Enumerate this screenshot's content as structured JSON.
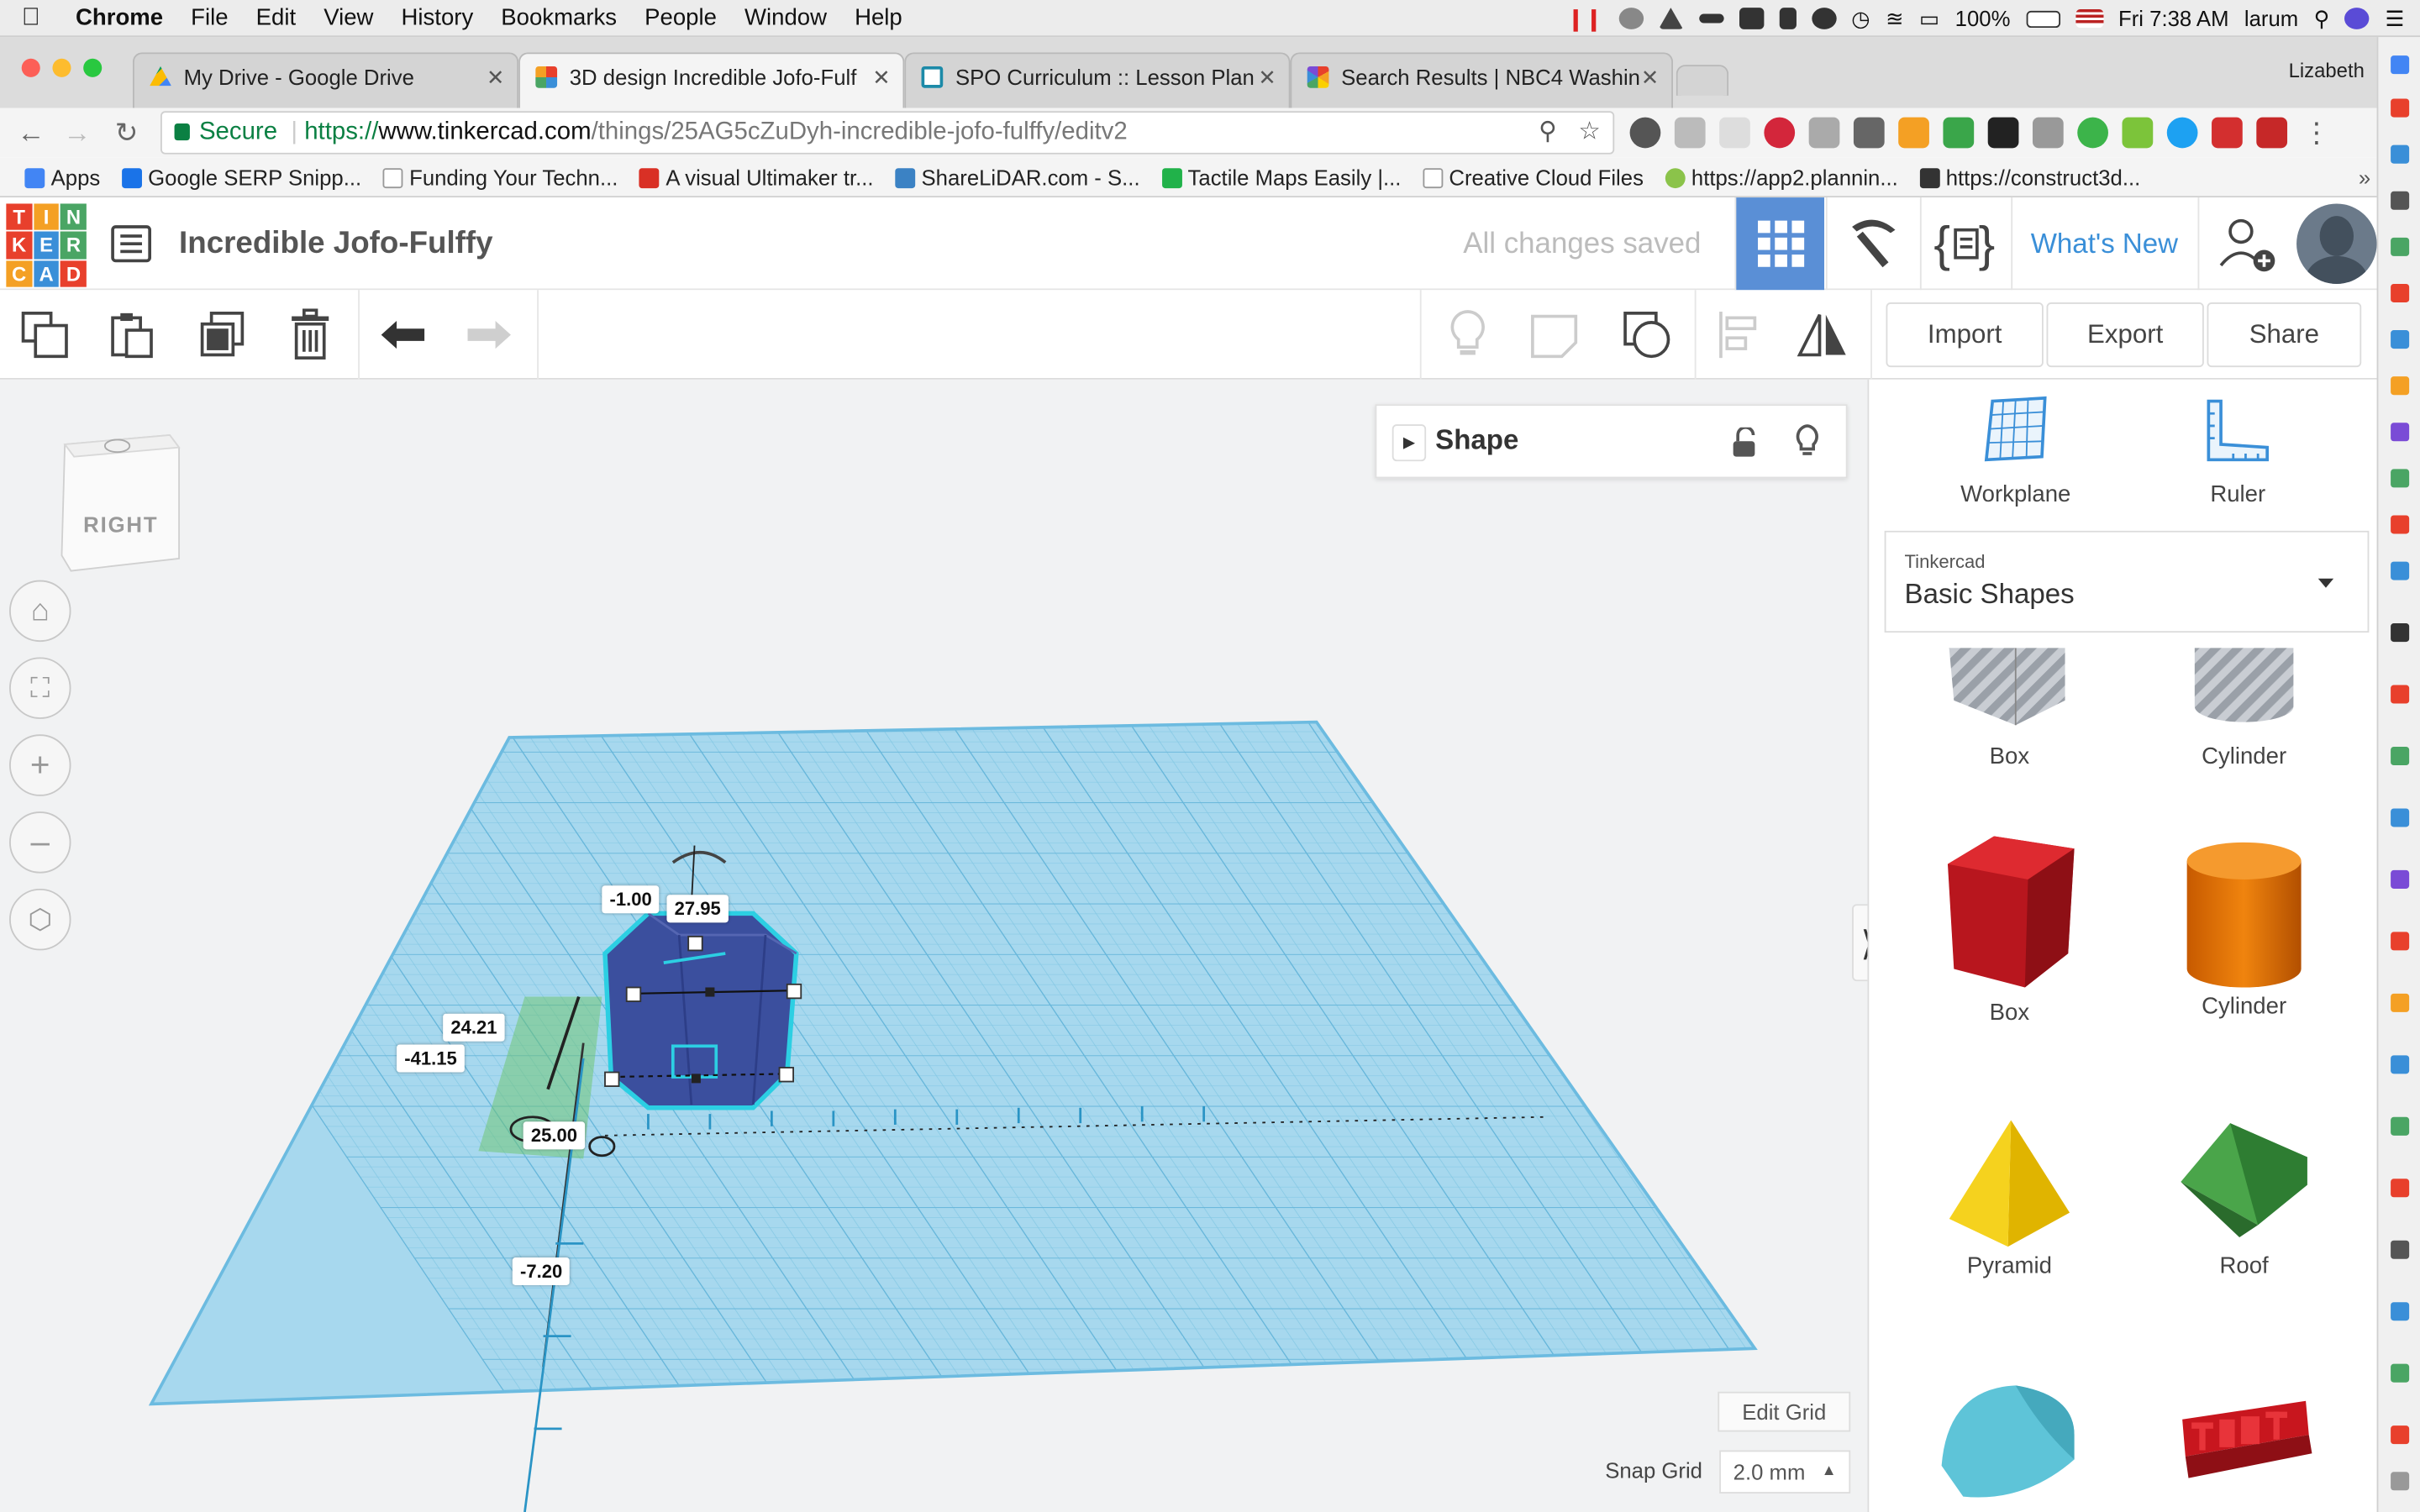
{
  "mac_menu": {
    "app": "Chrome",
    "items": [
      "File",
      "Edit",
      "View",
      "History",
      "Bookmarks",
      "People",
      "Window",
      "Help"
    ],
    "battery": "100%",
    "clock": "Fri 7:38 AM",
    "user": "larum"
  },
  "browser": {
    "profile_name": "Lizabeth",
    "tabs": [
      {
        "title": "My Drive - Google Drive",
        "icon": "google-drive-icon"
      },
      {
        "title": "3D design Incredible Jofo-Fulf​",
        "icon": "tinkercad-icon"
      },
      {
        "title": "SPO Curriculum :: Lesson Plan​",
        "icon": "lesson-icon"
      },
      {
        "title": "Search Results | NBC4 Washin​",
        "icon": "nbc-icon"
      }
    ],
    "active_tab_index": 1,
    "url": {
      "secure_label": "Secure",
      "scheme": "https://",
      "host": "www.tinkercad.com",
      "path": "/things/25AG5cZuDyh-incredible-jofo-fulffy/editv2"
    },
    "bookmarks": [
      {
        "label": "Apps",
        "color": "#4285f4"
      },
      {
        "label": "Google SERP Snipp...",
        "color": "#1a73e8"
      },
      {
        "label": "Funding Your Techn...",
        "color": "#cccccc"
      },
      {
        "label": "A visual Ultimaker tr...",
        "color": "#d93025"
      },
      {
        "label": "ShareLiDAR.com - S...",
        "color": "#3b82c4"
      },
      {
        "label": "Tactile Maps Easily |...",
        "color": "#21b24a"
      },
      {
        "label": "Creative Cloud Files",
        "color": "#cccccc"
      },
      {
        "label": "https://app2.plannin...",
        "color": "#8bc34a"
      },
      {
        "label": "https://construct3d...",
        "color": "#333333"
      }
    ]
  },
  "tinkercad": {
    "logo_letters": [
      "T",
      "I",
      "N",
      "K",
      "E",
      "R",
      "C",
      "A",
      "D"
    ],
    "logo_colors": [
      "#e8402c",
      "#f4a024",
      "#4aa564",
      "#e8402c",
      "#3a8fd8",
      "#4aa564",
      "#f4a024",
      "#3a8fd8",
      "#e8402c"
    ],
    "design_name": "Incredible Jofo-Fulffy",
    "save_status": "All changes saved",
    "whats_new": "What's New",
    "toolbar": {
      "import": "Import",
      "export": "Export",
      "share": "Share"
    },
    "view_cube_face": "RIGHT",
    "shape_panel_title": "Shape",
    "dimensions": {
      "rotation": "-1.00",
      "length": "27.95",
      "height": "24.21",
      "elevation": "-41.15",
      "width": "25.00",
      "offset": "-7.20"
    },
    "edit_grid": "Edit Grid",
    "snap_grid_label": "Snap Grid",
    "snap_grid_value": "2.0 mm",
    "right_panel": {
      "workplane": "Workplane",
      "ruler": "Ruler",
      "library_source": "Tinkercad",
      "library_name": "Basic Shapes",
      "shapes": [
        "Box",
        "Cylinder",
        "Box",
        "Cylinder",
        "Pyramid",
        "Roof"
      ]
    },
    "colors": {
      "accent_blue": "#3a8fd8",
      "active_grid_btn": "#5a8fd6",
      "workplane": "#a7d8ee",
      "selected_shape": "#3b4f9e"
    }
  }
}
